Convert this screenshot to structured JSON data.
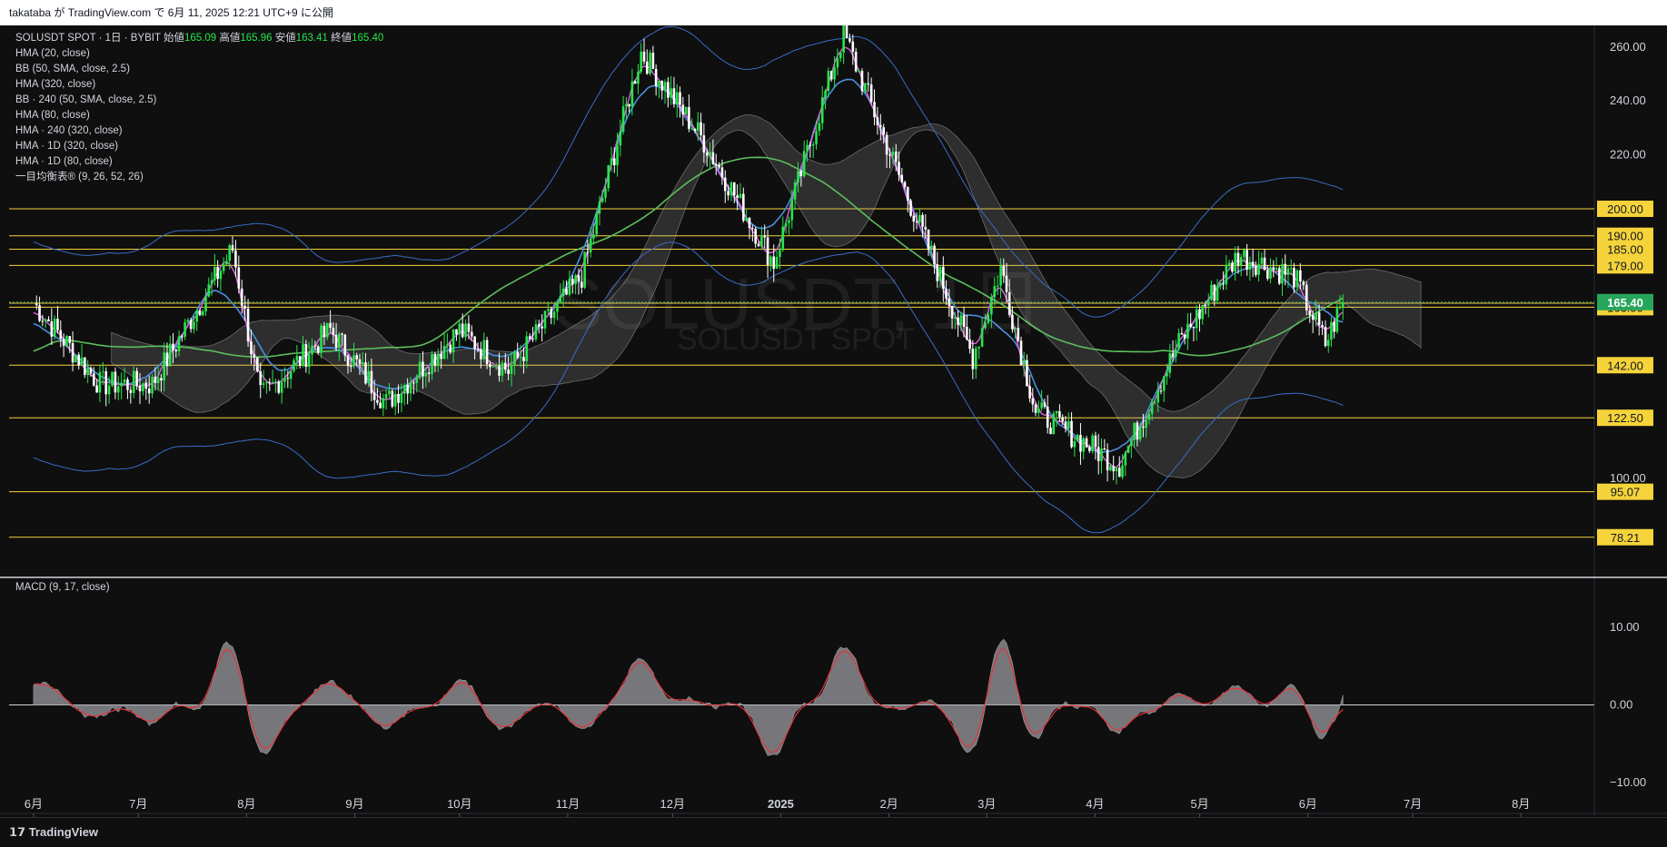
{
  "header": {
    "publish_text": "takataba が TradingView.com で 6月 11, 2025 12:21 UTC+9 に公開"
  },
  "footer": {
    "brand": "TradingView"
  },
  "watermark": {
    "symbol": "SOLUSDT, 1日",
    "description": "SOLUSDT SPOT"
  },
  "legend": {
    "symbol_line": "SOLUSDT SPOT · 1日 · BYBIT",
    "open_label": "始値",
    "open": "165.09",
    "high_label": "高値",
    "high": "165.96",
    "low_label": "安値",
    "low": "163.41",
    "close_label": "終値",
    "close": "165.40",
    "indicators": [
      "HMA (20, close)",
      "BB (50, SMA, close, 2.5)",
      "HMA (320, close)",
      "BB · 240 (50, SMA, close, 2.5)",
      "HMA (80, close)",
      "HMA · 240 (320, close)",
      "HMA · 1D (320, close)",
      "HMA · 1D (80, close)",
      "一目均衡表® (9, 26, 52, 26)"
    ],
    "macd_label": "MACD (9, 17, close)"
  },
  "colors": {
    "up": "#26e54a",
    "down": "#ffffff",
    "hma20": "#e060e0",
    "hma_blue": "#4a8ee0",
    "hma_green": "#5bbf5b",
    "bb": "#3a6cc8",
    "level": "#f5d33a",
    "macd_line": "#e0353b",
    "histogram": "#8a8a8e",
    "price_badge": "#26a65b"
  },
  "chart_data": [
    {
      "type": "candlestick",
      "title": "SOLUSDT SPOT · 1日 · BYBIT",
      "y_ticks": [
        "260.00",
        "240.00",
        "220.00",
        "100.00"
      ],
      "ylim": [
        65,
        268
      ],
      "x_ticks": [
        "6月",
        "7月",
        "8月",
        "9月",
        "10月",
        "11月",
        "12月",
        "2025",
        "2月",
        "3月",
        "4月",
        "5月",
        "6月",
        "7月",
        "8月"
      ],
      "level_labels": [
        "200.00",
        "190.00",
        "185.00",
        "179.00",
        "165.00",
        "163.50",
        "142.00",
        "122.50",
        "95.07",
        "78.21"
      ],
      "levels": [
        200,
        190,
        185,
        179,
        165,
        163.5,
        142,
        122.5,
        95.07,
        78.21
      ],
      "last_price": "165.40",
      "approx_close_path": [
        [
          "2024-06-01",
          165
        ],
        [
          "2024-06-20",
          135
        ],
        [
          "2024-07-05",
          135
        ],
        [
          "2024-07-28",
          185
        ],
        [
          "2024-08-05",
          130
        ],
        [
          "2024-08-25",
          155
        ],
        [
          "2024-09-10",
          128
        ],
        [
          "2024-10-01",
          155
        ],
        [
          "2024-10-15",
          140
        ],
        [
          "2024-11-05",
          175
        ],
        [
          "2024-11-22",
          258
        ],
        [
          "2024-12-10",
          225
        ],
        [
          "2024-12-30",
          180
        ],
        [
          "2025-01-19",
          265
        ],
        [
          "2025-02-03",
          215
        ],
        [
          "2025-02-25",
          145
        ],
        [
          "2025-03-05",
          178
        ],
        [
          "2025-03-15",
          125
        ],
        [
          "2025-04-08",
          105
        ],
        [
          "2025-04-25",
          150
        ],
        [
          "2025-05-12",
          183
        ],
        [
          "2025-05-28",
          175
        ],
        [
          "2025-06-06",
          150
        ],
        [
          "2025-06-11",
          165.4
        ]
      ]
    },
    {
      "type": "area",
      "title": "MACD (9, 17, close)",
      "y_ticks": [
        "10.00",
        "0.00",
        "−10.00"
      ],
      "ylim": [
        -14,
        16
      ]
    }
  ]
}
